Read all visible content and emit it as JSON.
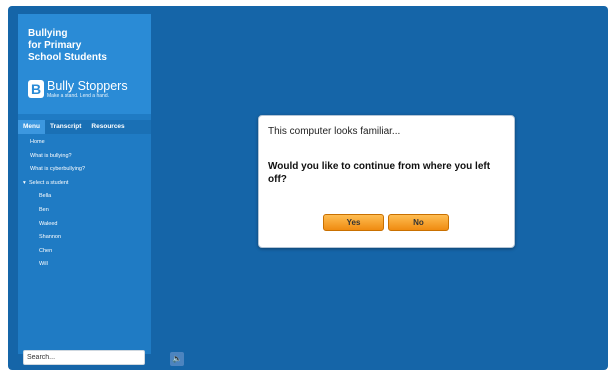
{
  "logo": {
    "title_lines": [
      "Bullying",
      "for Primary",
      "School Students"
    ],
    "brand_mark": "B",
    "brand_name": "Bully Stoppers",
    "brand_tagline": "Make a stand. Lend a hand."
  },
  "sidebar": {
    "tabs": [
      {
        "label": "Menu",
        "active": true
      },
      {
        "label": "Transcript",
        "active": false
      },
      {
        "label": "Resources",
        "active": false
      }
    ],
    "menu": [
      {
        "label": "Home"
      },
      {
        "label": "What is bullying?"
      },
      {
        "label": "What is cyberbullying?"
      },
      {
        "label": "Select a student",
        "bullet": "▾"
      },
      {
        "label": "Bella"
      },
      {
        "label": "Ben"
      },
      {
        "label": "Waleed"
      },
      {
        "label": "Shannon"
      },
      {
        "label": "Chen"
      },
      {
        "label": "Will"
      }
    ],
    "search_placeholder": "Search..."
  },
  "audio": {
    "icon": "speaker-icon",
    "glyph": "🔈"
  },
  "dialog": {
    "title": "This computer looks familiar...",
    "question": "Would you like to continue from where you left off?",
    "yes_label": "Yes",
    "no_label": "No"
  },
  "colors": {
    "background": "#1565a8",
    "sidebar": "#1f7bc4",
    "button": "#f39c1a"
  }
}
